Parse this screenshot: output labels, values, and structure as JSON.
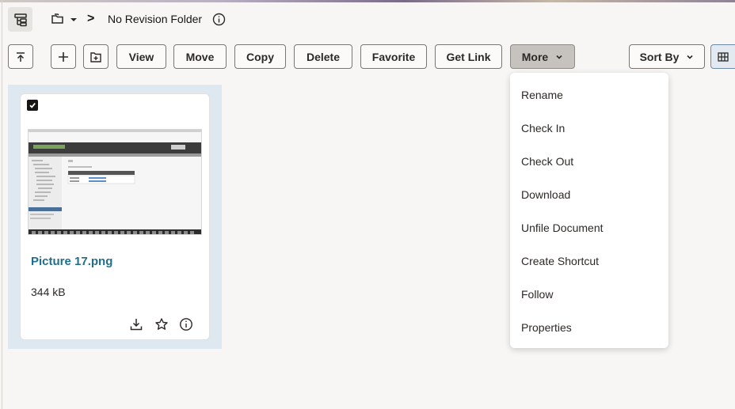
{
  "breadcrumb": {
    "current_folder": "No Revision Folder",
    "separator": ">",
    "icons": {
      "tree": "tree-view-icon",
      "folder": "folder-copy-icon",
      "info": "info-icon"
    }
  },
  "toolbar": {
    "up_icon": "up-level-icon",
    "new_icon": "plus-icon",
    "upload_icon": "new-folder-icon",
    "view_label": "View",
    "move_label": "Move",
    "copy_label": "Copy",
    "delete_label": "Delete",
    "favorite_label": "Favorite",
    "get_link_label": "Get Link",
    "more_label": "More",
    "sort_label": "Sort By",
    "grid_icon": "grid-view-icon"
  },
  "more_menu": {
    "items": [
      {
        "label": "Rename"
      },
      {
        "label": "Check In"
      },
      {
        "label": "Check Out"
      },
      {
        "label": "Download"
      },
      {
        "label": "Unfile Document"
      },
      {
        "label": "Create Shortcut"
      },
      {
        "label": "Follow"
      },
      {
        "label": "Properties"
      }
    ]
  },
  "file_card": {
    "name": "Picture 17.png",
    "size": "344 kB",
    "selected": true,
    "actions": [
      "download-icon",
      "star-icon",
      "info-icon"
    ]
  },
  "colors": {
    "link": "#1f6f8b",
    "selection": "#dde8f0",
    "active_button": "#c6c3bf"
  }
}
